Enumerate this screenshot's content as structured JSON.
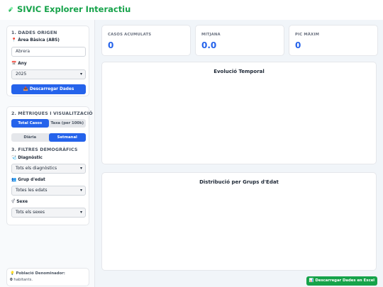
{
  "header": {
    "title": "SIVIC Explorer Interactiu",
    "logo_icon": "pill-icon"
  },
  "sidebar": {
    "section1_title": "1. DADES ORIGEN",
    "abs": {
      "label": "Àrea Bàsica (ABS)",
      "icon": "pin-icon",
      "value": "Abrera"
    },
    "year": {
      "label": "Any",
      "icon": "calendar-icon",
      "value": "2025"
    },
    "download_button": "Descarregar Dades",
    "section2_title": "2. MÈTRIQUES I VISUALITZACIÓ",
    "metric_toggle": {
      "options": [
        "Total Casos",
        "Taxa (per 100k)"
      ],
      "selected": "Total Casos"
    },
    "period_toggle": {
      "options": [
        "Diària",
        "Setmanal"
      ],
      "selected": "Setmanal"
    },
    "section3_title": "3. FILTRES DEMOGRÀFICS",
    "diagnosis": {
      "label": "Diagnòstic",
      "icon": "clipboard-icon",
      "value": "Tots els diagnòstics"
    },
    "age_group": {
      "label": "Grup d'edat",
      "icon": "people-icon",
      "value": "Totes les edats"
    },
    "sex": {
      "label": "Sexe",
      "icon": "gender-icon",
      "value": "Tots els sexes"
    },
    "population": {
      "label": "Població Denominador:",
      "value": "0",
      "unit": "habitants.",
      "icon": "bulb-icon"
    }
  },
  "stats": [
    {
      "label": "CASOS ACUMULATS",
      "value": "0"
    },
    {
      "label": "MITJANA",
      "value": "0.0"
    },
    {
      "label": "PIC MÀXIM",
      "value": "0"
    }
  ],
  "charts": {
    "temporal_title": "Evolució Temporal",
    "age_title": "Distribució per Grups d'Edat"
  },
  "excel_button": "Descarregar Dades en Excel",
  "colors": {
    "accent_blue": "#2563eb",
    "accent_green": "#16a34a"
  }
}
